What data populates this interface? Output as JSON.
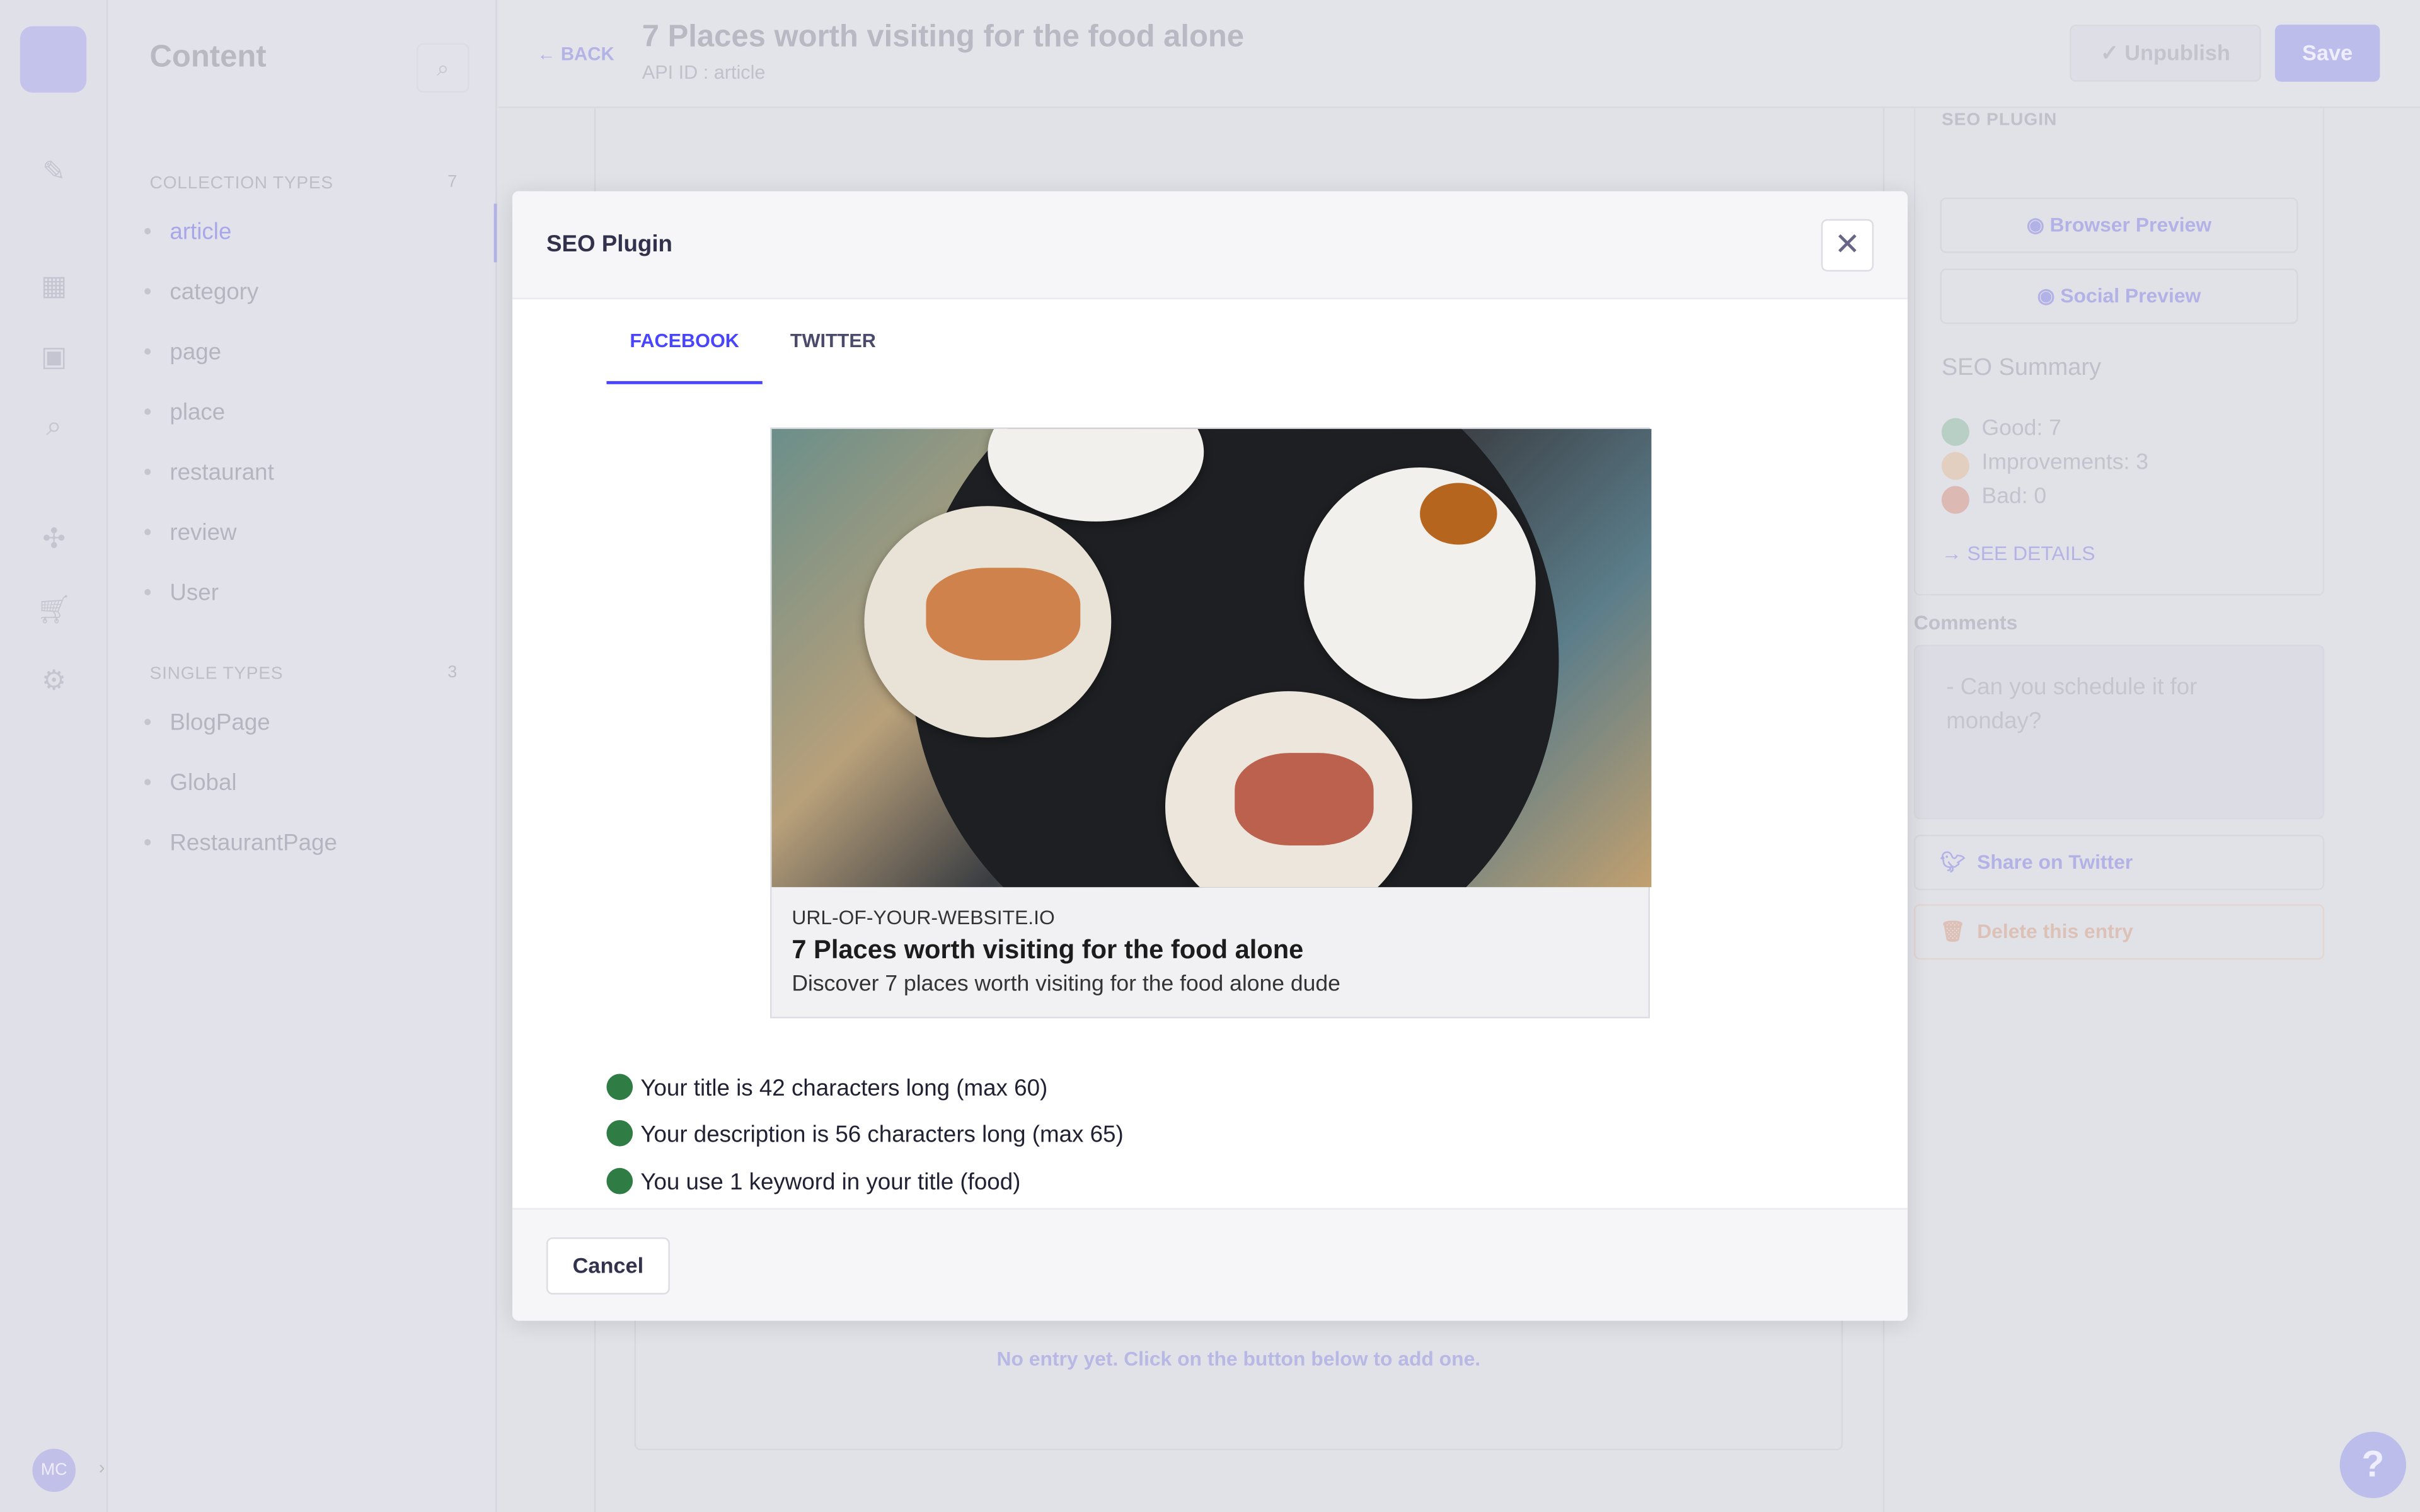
{
  "sidebar": {
    "title": "Content",
    "collection_label": "COLLECTION TYPES",
    "collection_count": "7",
    "collection_items": [
      "article",
      "category",
      "page",
      "place",
      "restaurant",
      "review",
      "User"
    ],
    "single_label": "SINGLE TYPES",
    "single_count": "3",
    "single_items": [
      "BlogPage",
      "Global",
      "RestaurantPage"
    ],
    "avatar": "MC"
  },
  "header": {
    "back": "BACK",
    "title": "7 Places worth visiting for the food alone",
    "api_id": "API ID : article",
    "unpublish": "Unpublish",
    "save": "Save"
  },
  "right_panel": {
    "seo_plugin": "SEO PLUGIN",
    "browser_preview": "Browser Preview",
    "social_preview": "Social Preview",
    "summary_title": "SEO Summary",
    "good": "Good: 7",
    "improvements": "Improvements: 3",
    "bad": "Bad: 0",
    "see_details": "SEE DETAILS",
    "comments_label": "Comments",
    "comment": "- Can you schedule it for monday?",
    "share_twitter": "Share on Twitter",
    "delete": "Delete this entry",
    "colors": {
      "good": "#b7cfc4",
      "improvements": "#e2cfbf",
      "bad": "#ddb9b4"
    }
  },
  "main": {
    "empty_text": "No entry yet. Click on the button below to add one."
  },
  "modal": {
    "title": "SEO Plugin",
    "tabs": [
      {
        "label": "FACEBOOK",
        "active": true
      },
      {
        "label": "TWITTER",
        "active": false
      }
    ],
    "preview": {
      "url": "URL-OF-YOUR-WEBSITE.IO",
      "title": "7 Places worth visiting for the food alone",
      "description": "Discover 7 places worth visiting for the food alone dude"
    },
    "checks": [
      "Your title is 42 characters long (max 60)",
      "Your description is 56 characters long (max 65)",
      "You use 1 keyword in your title (food)"
    ],
    "cancel": "Cancel",
    "accent": "#4945ff",
    "check_color": "#2f7d45"
  }
}
